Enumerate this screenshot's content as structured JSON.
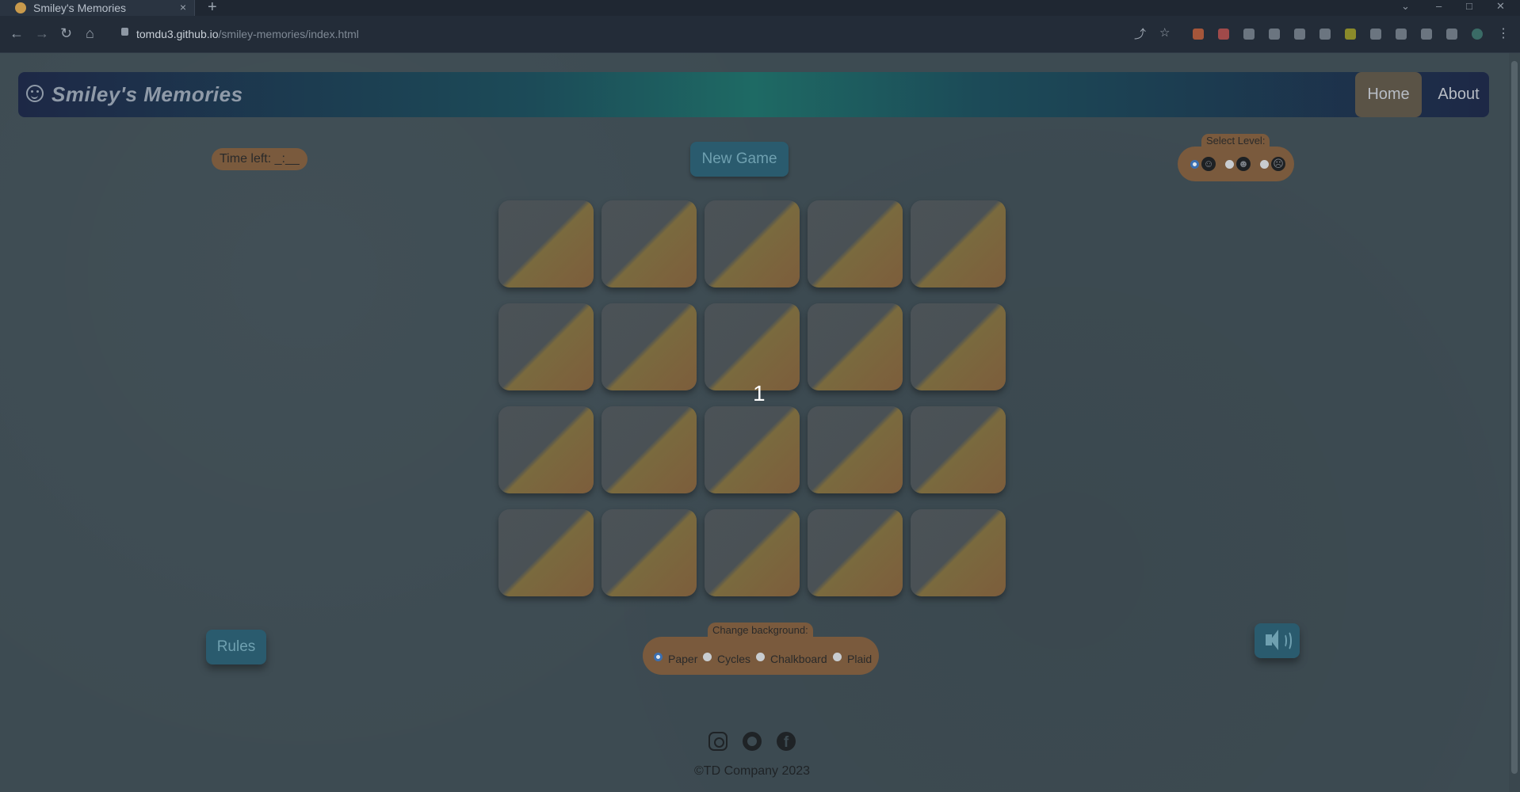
{
  "browser": {
    "tab_title": "Smiley's Memories",
    "tab_close": "×",
    "new_tab": "+",
    "url_host": "tomdu3.github.io",
    "url_path": "/smiley-memories/index.html"
  },
  "header": {
    "brand": "Smiley's Memories",
    "nav": [
      {
        "label": "Home",
        "active": true
      },
      {
        "label": "About",
        "active": false
      }
    ]
  },
  "game": {
    "time_left_label": "Time left: _:__",
    "new_game_label": "New Game",
    "countdown": "1",
    "rows": 4,
    "cols": 5,
    "level": {
      "label": "Select Level:",
      "options": [
        {
          "face": "neutral-face-icon",
          "glyph": "☺",
          "selected": true
        },
        {
          "face": "smile-face-icon",
          "glyph": "☻",
          "selected": false
        },
        {
          "face": "sad-face-icon",
          "glyph": "☹",
          "selected": false
        }
      ]
    }
  },
  "controls": {
    "rules_label": "Rules",
    "background": {
      "label": "Change background:",
      "options": [
        "Paper",
        "Cycles",
        "Chalkboard",
        "Plaid"
      ],
      "selected": "Paper"
    },
    "sound_icon": "volume-icon"
  },
  "footer": {
    "copyright": "©TD Company 2023",
    "social": [
      "instagram-icon",
      "github-icon",
      "facebook-icon"
    ],
    "facebook_glyph": "f"
  },
  "colors": {
    "header_gradient": [
      "#1d2846",
      "#1e6a64"
    ],
    "button": "#2a5b6e",
    "pill": "#7a5a3d",
    "card_back": "#7d5d3c"
  }
}
